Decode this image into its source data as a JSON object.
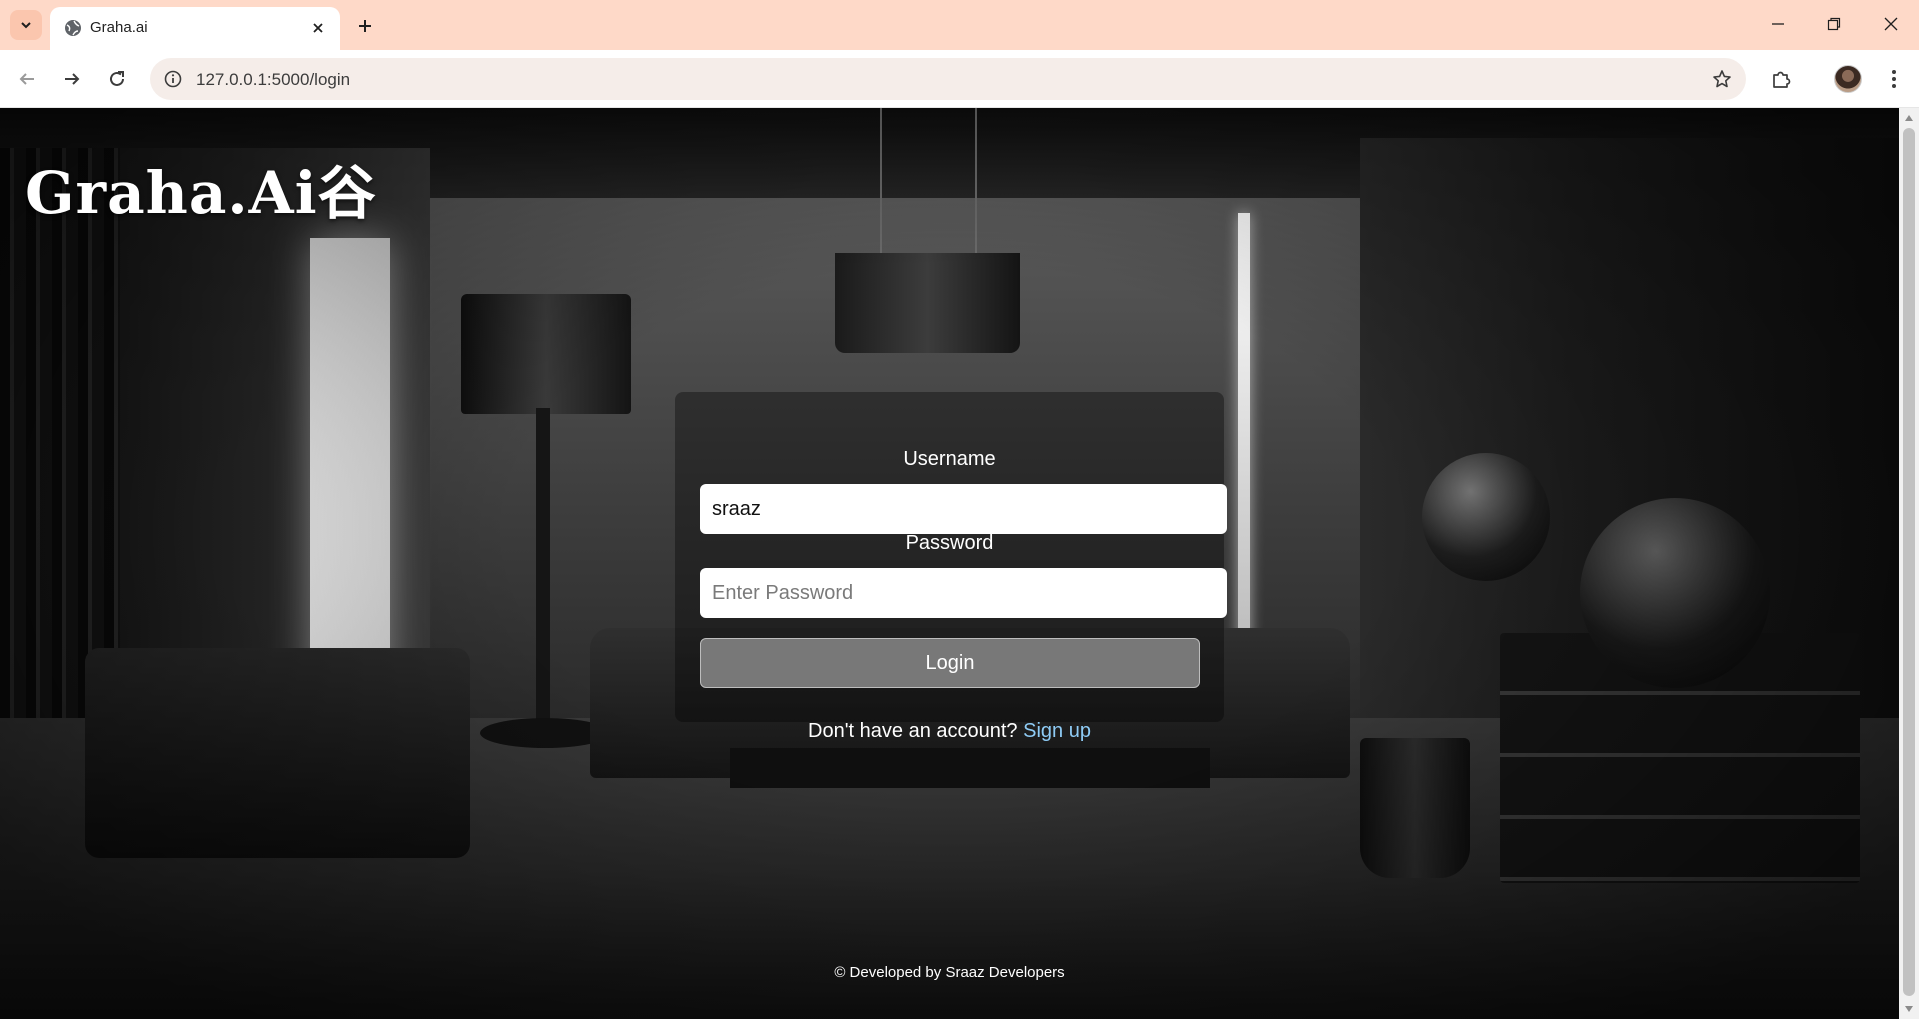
{
  "browser": {
    "tab_title": "Graha.ai",
    "url": "127.0.0.1:5000/login",
    "icons": {
      "tab_search": "chevron-down-icon",
      "favicon": "globe-icon",
      "tab_close": "close-icon",
      "new_tab": "plus-icon",
      "back": "arrow-left-icon",
      "forward": "arrow-right-icon",
      "reload": "reload-icon",
      "site_info": "info-icon",
      "bookmark": "star-icon",
      "extensions": "puzzle-icon",
      "menu": "kebab-menu-icon"
    },
    "colors": {
      "frame": "#fed9c8",
      "omnibox": "#f5ede9"
    }
  },
  "page": {
    "brand": "Graha.Ai谷",
    "form": {
      "username_label": "Username",
      "username_value": "sraaz",
      "password_label": "Password",
      "password_placeholder": "Enter Password",
      "login_button": "Login"
    },
    "signup_prompt": "Don't have an account?",
    "signup_link": "Sign up",
    "footer": "© Developed by Sraaz Developers",
    "colors": {
      "link": "#8ecbf5",
      "button": "#787878"
    }
  }
}
